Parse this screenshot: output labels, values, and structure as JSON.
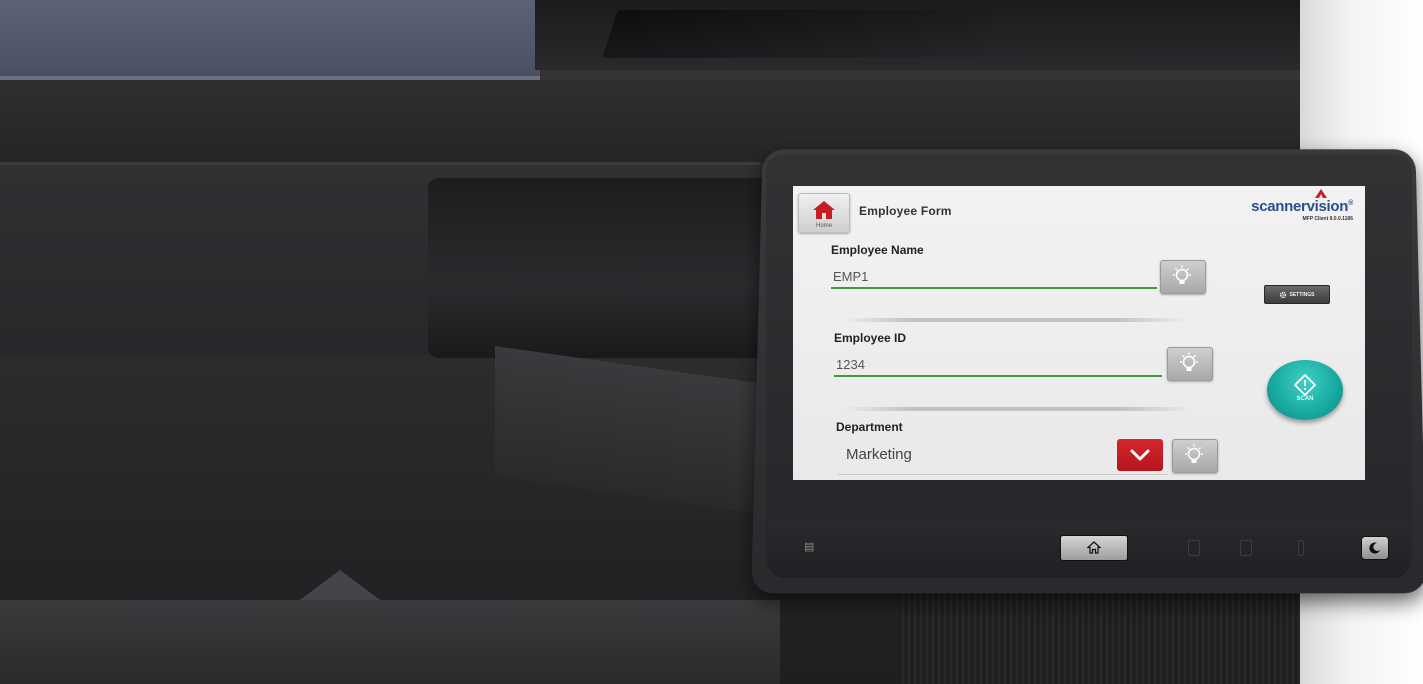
{
  "screen": {
    "header": {
      "home_button_label": "Home",
      "form_title": "Employee Form"
    },
    "brand": {
      "name": "scannervision",
      "superscript": "®",
      "version_text": "MFP Client 9.0.0.1186",
      "brand_color": "#2a4f8f"
    },
    "fields": [
      {
        "label": "Employee Name",
        "value": "EMP1",
        "hint_icon": "lightbulb-icon"
      },
      {
        "label": "Employee ID",
        "value": "1234",
        "hint_icon": "lightbulb-icon"
      }
    ],
    "department": {
      "label": "Department",
      "selected": "Marketing",
      "dropdown_icon": "chevron-down-icon",
      "hint_icon": "lightbulb-icon"
    },
    "settings_button": {
      "label": "SETTINGS",
      "icon": "gear-icon"
    },
    "scan_button": {
      "label": "SCAN",
      "icon": "start-icon",
      "color": "#17a89f"
    },
    "colors": {
      "accent_green": "#3a9c3a",
      "dropdown_red": "#c41d24",
      "home_red": "#c41d24"
    }
  },
  "hardware": {
    "home_key_icon": "home-icon",
    "power_key_icon": "sleep-icon",
    "nfc_icon": "nfc-icon"
  }
}
